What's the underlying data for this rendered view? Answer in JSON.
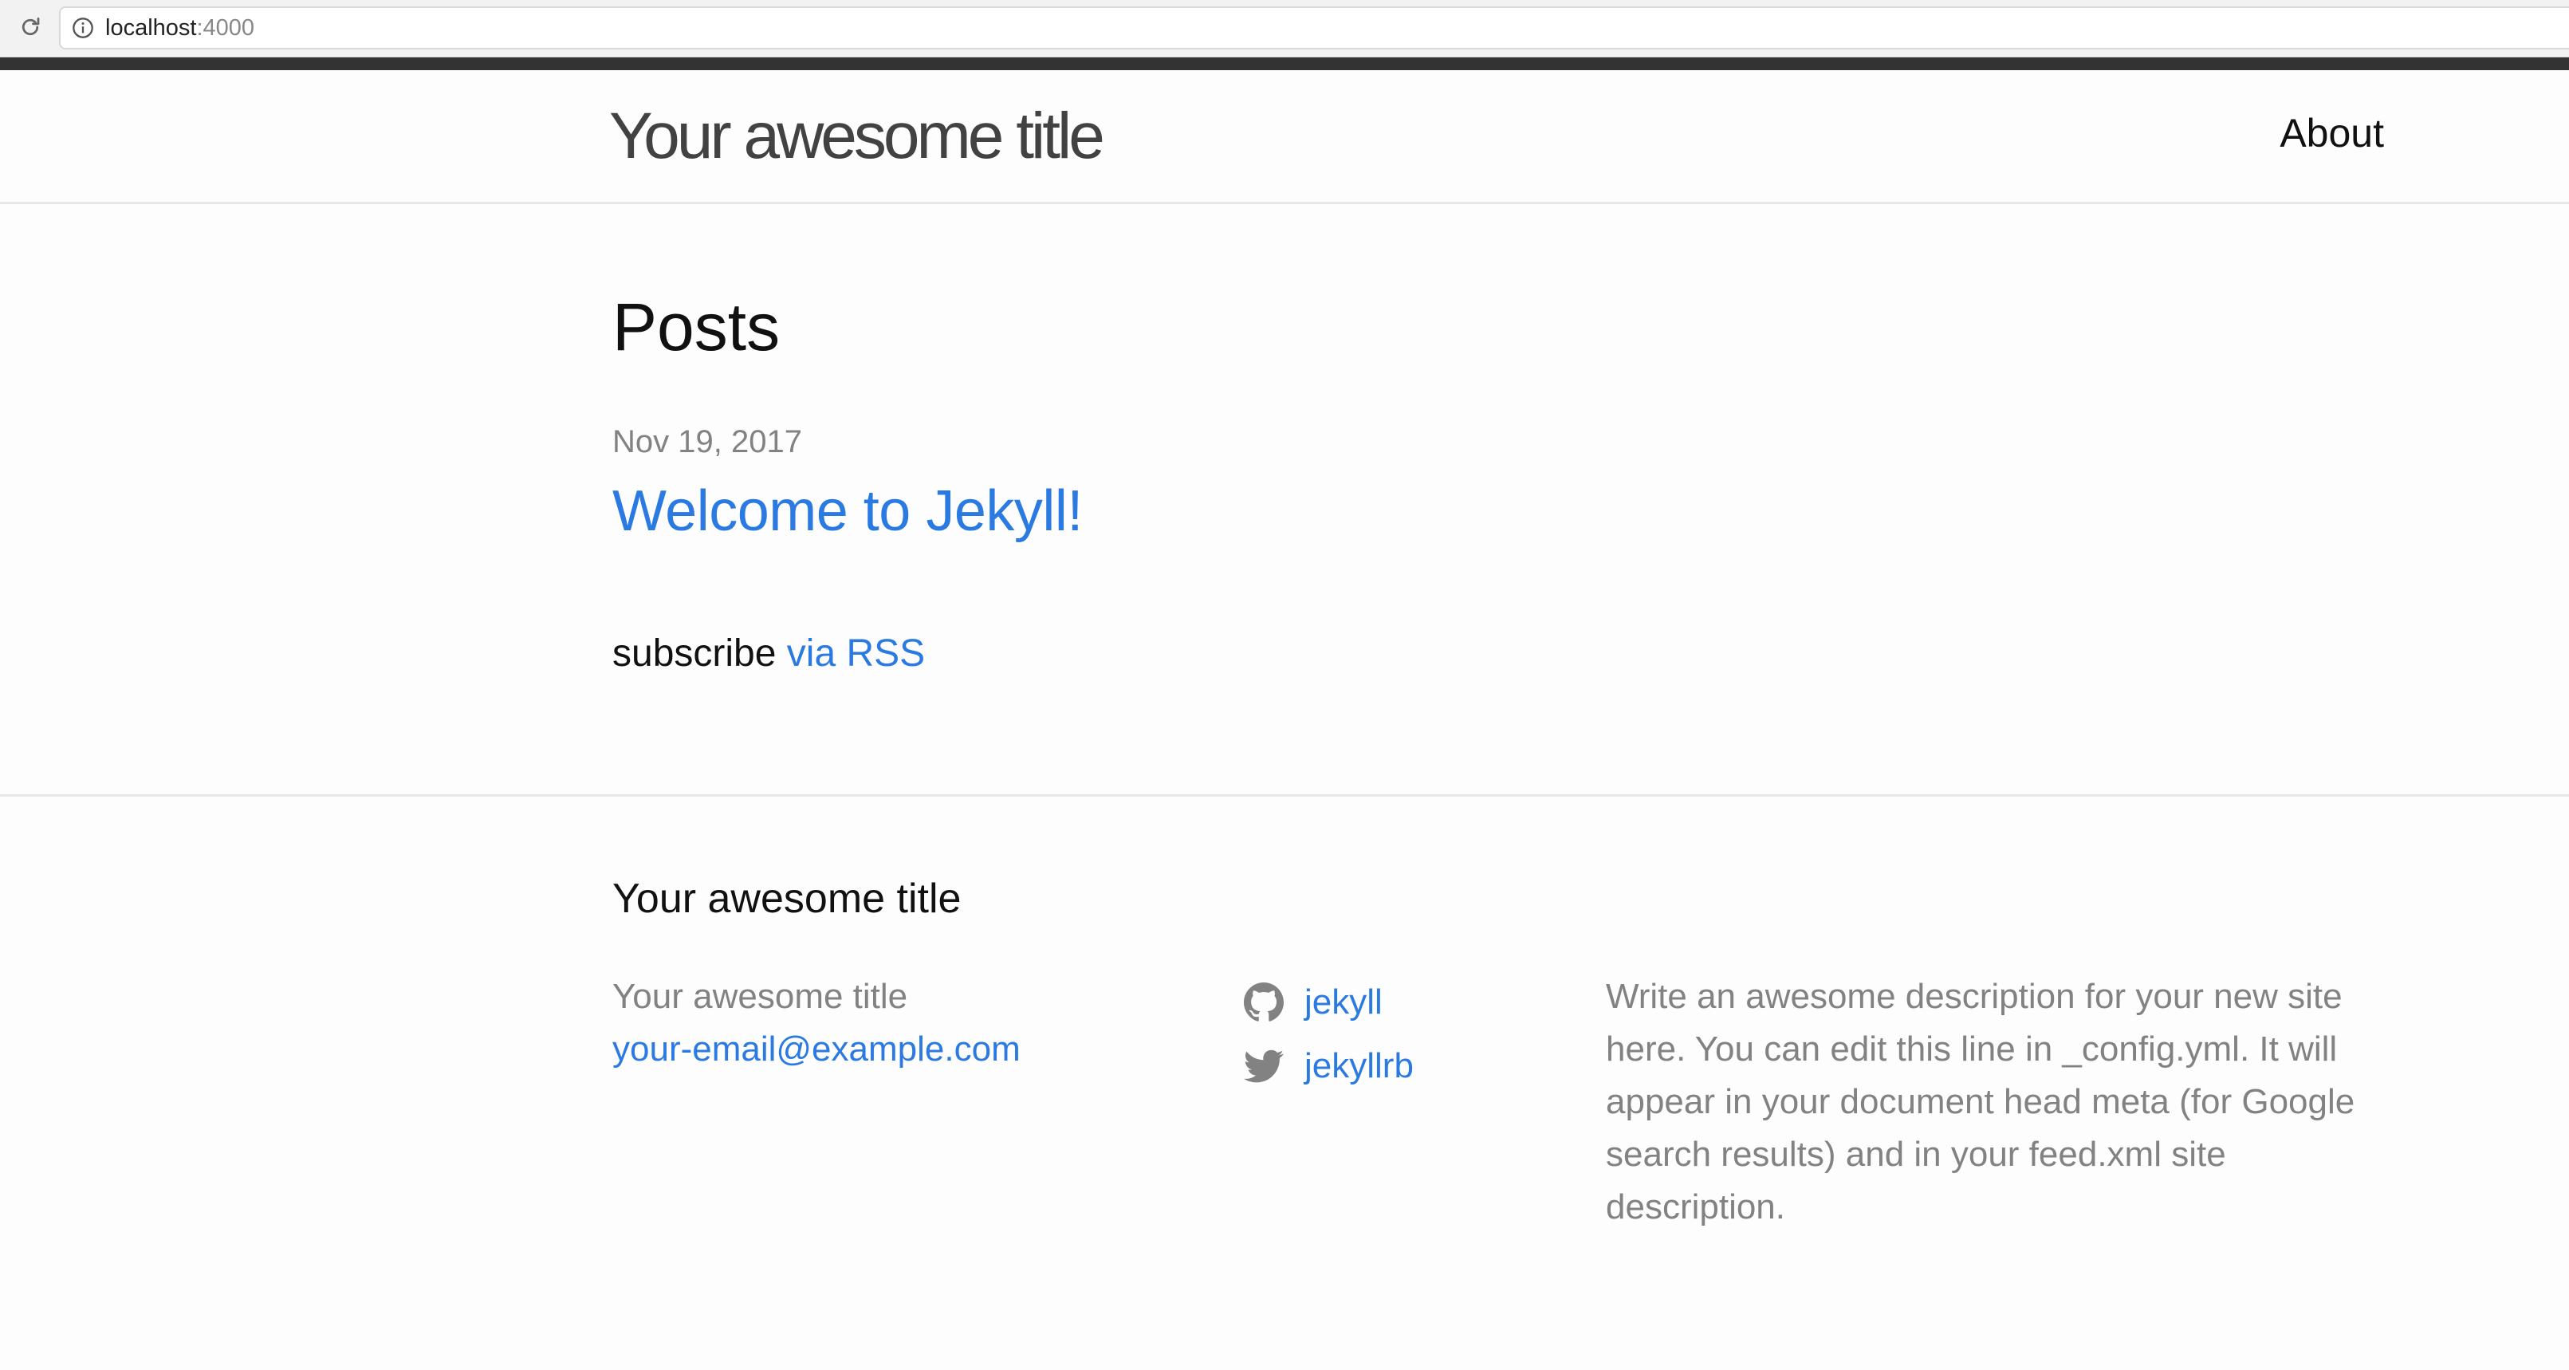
{
  "browser": {
    "url_host": "localhost",
    "url_port": ":4000",
    "reload_icon": "reload-icon",
    "info_icon": "info-icon"
  },
  "header": {
    "site_title": "Your awesome title",
    "nav": [
      {
        "label": "About"
      }
    ]
  },
  "main": {
    "heading": "Posts",
    "posts": [
      {
        "date": "Nov 19, 2017",
        "title": "Welcome to Jekyll!"
      }
    ],
    "subscribe_prefix": "subscribe",
    "subscribe_link": "via RSS"
  },
  "footer": {
    "heading": "Your awesome title",
    "name": "Your awesome title",
    "email": "your-email@example.com",
    "social": [
      {
        "icon": "github-icon",
        "label": "jekyll"
      },
      {
        "icon": "twitter-icon",
        "label": "jekyllrb"
      }
    ],
    "description": "Write an awesome description for your new site here. You can edit this line in _config.yml. It will appear in your document head meta (for Google search results) and in your feed.xml site description."
  },
  "colors": {
    "link": "#2a7ae2",
    "meta_text": "#828282",
    "stripe": "#333333",
    "background": "#fdfdfd"
  }
}
